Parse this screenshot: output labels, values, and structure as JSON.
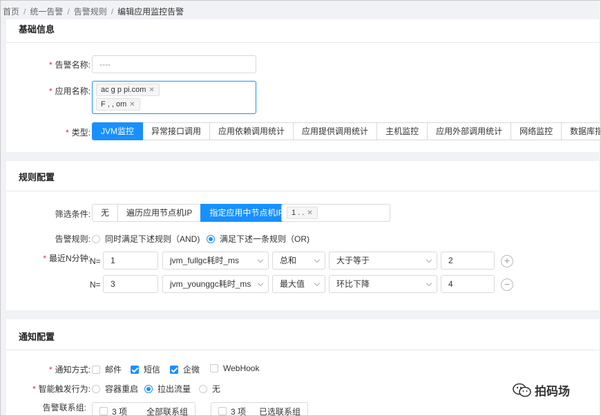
{
  "breadcrumb": [
    "首页",
    "统一告警",
    "告警规则",
    "编辑应用监控告警"
  ],
  "basic": {
    "title": "基础信息",
    "alert_name_label": "告警名称:",
    "alert_name_value": "----",
    "app_name_label": "应用名称:",
    "app_tags": [
      "ac  g   p   pi.com",
      "F   ,  ,  om"
    ],
    "type_label": "类型:",
    "types": [
      "JVM监控",
      "异常接口调用",
      "应用依赖调用统计",
      "应用提供调用统计",
      "主机监控",
      "应用外部调用统计",
      "网络监控",
      "数据库指标"
    ],
    "active_type": "JVM监控"
  },
  "rules": {
    "title": "规则配置",
    "filter_label": "筛选条件:",
    "filters": [
      "无",
      "遍历应用节点机IP",
      "指定应用中节点机IP"
    ],
    "active_filter": "指定应用中节点机IP",
    "ip_tag": "1  .  .",
    "alert_rule_label": "告警规则:",
    "alert_rule_options": [
      "同时满足下述规则（AND)",
      "满足下述一条规则（OR)"
    ],
    "alert_rule_selected": "满足下述一条规则（OR)",
    "recent_label": "最近N分钟:",
    "n_prefix": "N=",
    "rows": [
      {
        "n": "1",
        "metric": "jvm_fullgc耗时_ms",
        "agg": "总和",
        "cmp": "大于等于",
        "threshold": "2",
        "action": "+"
      },
      {
        "n": "3",
        "metric": "jvm_younggc耗时_ms",
        "agg": "最大值",
        "cmp": "环比下降",
        "threshold": "4",
        "action": "−"
      }
    ]
  },
  "notify": {
    "title": "通知配置",
    "method_label": "通知方式:",
    "methods": [
      {
        "label": "邮件",
        "checked": false
      },
      {
        "label": "短信",
        "checked": true
      },
      {
        "label": "企微",
        "checked": true
      },
      {
        "label": "WebHook",
        "checked": false
      }
    ],
    "action_label": "智能触发行为:",
    "actions": [
      "容器重启",
      "拉出流量",
      "无"
    ],
    "action_selected": "拉出流量",
    "group_label": "告警联系组:",
    "left_count": "3 项",
    "left_title": "全部联系组",
    "right_count": "3 项",
    "right_title": "已选联系组"
  },
  "watermark": "拍码场",
  "colors": {
    "primary": "#1890ff",
    "required": "#f5222d"
  }
}
